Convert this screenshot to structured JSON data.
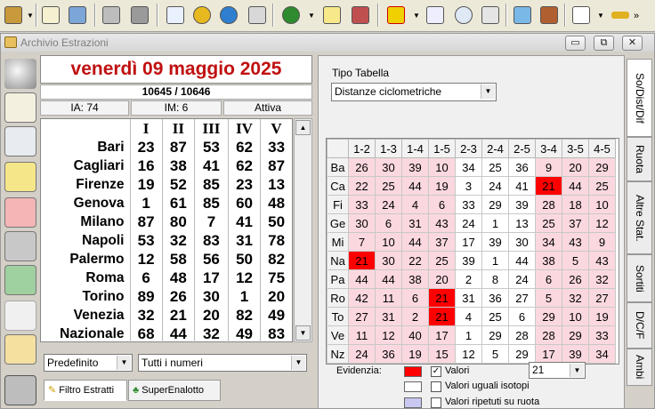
{
  "window": {
    "title": "Archivio Estrazioni",
    "btn_min": "▭",
    "btn_restore": "⧉",
    "btn_close": "✕"
  },
  "toolbar": {
    "icons": [
      "tools-icon",
      "edit-icon",
      "network-icon",
      "copy-icon",
      "clipboard-icon",
      "chart-icon",
      "coins-icon",
      "globe-icon",
      "filter-icon",
      "clover-icon",
      "ticket-icon",
      "package-icon",
      "square-icon",
      "window-icon",
      "magnifier-icon",
      "grid-icon",
      "notebook-icon",
      "wrench-icon",
      "checklist-icon",
      "key-icon"
    ]
  },
  "left": {
    "date": "venerdì 09 maggio 2025",
    "numbers": "10645 / 10646",
    "ia": "IA: 74",
    "im": "IM: 6",
    "status": "Attiva",
    "headers": [
      "I",
      "II",
      "III",
      "IV",
      "V"
    ],
    "rows": [
      {
        "city": "Bari",
        "v": [
          "23",
          "87",
          "53",
          "62",
          "33"
        ]
      },
      {
        "city": "Cagliari",
        "v": [
          "16",
          "38",
          "41",
          "62",
          "87"
        ]
      },
      {
        "city": "Firenze",
        "v": [
          "19",
          "52",
          "85",
          "23",
          "13"
        ]
      },
      {
        "city": "Genova",
        "v": [
          "1",
          "61",
          "85",
          "60",
          "48"
        ]
      },
      {
        "city": "Milano",
        "v": [
          "87",
          "80",
          "7",
          "41",
          "50"
        ]
      },
      {
        "city": "Napoli",
        "v": [
          "53",
          "32",
          "83",
          "31",
          "78"
        ]
      },
      {
        "city": "Palermo",
        "v": [
          "12",
          "58",
          "56",
          "50",
          "82"
        ]
      },
      {
        "city": "Roma",
        "v": [
          "6",
          "48",
          "17",
          "12",
          "75"
        ]
      },
      {
        "city": "Torino",
        "v": [
          "89",
          "26",
          "30",
          "1",
          "20"
        ]
      },
      {
        "city": "Venezia",
        "v": [
          "32",
          "21",
          "20",
          "82",
          "49"
        ]
      },
      {
        "city": "Nazionale",
        "v": [
          "68",
          "44",
          "32",
          "49",
          "83"
        ]
      }
    ],
    "combo1": "Predefinito",
    "combo2": "Tutti i numeri",
    "tab1": "Filtro Estratti",
    "tab2": "SuperEnalotto"
  },
  "right": {
    "tipo_label": "Tipo Tabella",
    "tipo_value": "Distanze ciclometriche",
    "col_headers": [
      "1-2",
      "1-3",
      "1-4",
      "1-5",
      "2-3",
      "2-4",
      "2-5",
      "3-4",
      "3-5",
      "4-5"
    ],
    "rows": [
      {
        "label": "Ba",
        "v": [
          "26",
          "30",
          "39",
          "10",
          "34",
          "25",
          "36",
          "9",
          "20",
          "29"
        ],
        "c": [
          "p",
          "p",
          "p",
          "p",
          "w",
          "w",
          "w",
          "p",
          "p",
          "p"
        ]
      },
      {
        "label": "Ca",
        "v": [
          "22",
          "25",
          "44",
          "19",
          "3",
          "24",
          "41",
          "21",
          "44",
          "25"
        ],
        "c": [
          "p",
          "p",
          "p",
          "p",
          "w",
          "w",
          "w",
          "r",
          "p",
          "p"
        ]
      },
      {
        "label": "Fi",
        "v": [
          "33",
          "24",
          "4",
          "6",
          "33",
          "29",
          "39",
          "28",
          "18",
          "10"
        ],
        "c": [
          "p",
          "p",
          "p",
          "p",
          "w",
          "w",
          "w",
          "p",
          "p",
          "p"
        ]
      },
      {
        "label": "Ge",
        "v": [
          "30",
          "6",
          "31",
          "43",
          "24",
          "1",
          "13",
          "25",
          "37",
          "12"
        ],
        "c": [
          "p",
          "p",
          "p",
          "p",
          "w",
          "w",
          "w",
          "p",
          "p",
          "p"
        ]
      },
      {
        "label": "Mi",
        "v": [
          "7",
          "10",
          "44",
          "37",
          "17",
          "39",
          "30",
          "34",
          "43",
          "9"
        ],
        "c": [
          "p",
          "p",
          "p",
          "p",
          "w",
          "w",
          "w",
          "p",
          "p",
          "p"
        ]
      },
      {
        "label": "Na",
        "v": [
          "21",
          "30",
          "22",
          "25",
          "39",
          "1",
          "44",
          "38",
          "5",
          "43"
        ],
        "c": [
          "r",
          "p",
          "p",
          "p",
          "w",
          "w",
          "w",
          "p",
          "p",
          "p"
        ]
      },
      {
        "label": "Pa",
        "v": [
          "44",
          "44",
          "38",
          "20",
          "2",
          "8",
          "24",
          "6",
          "26",
          "32"
        ],
        "c": [
          "p",
          "p",
          "p",
          "p",
          "w",
          "w",
          "w",
          "p",
          "p",
          "p"
        ]
      },
      {
        "label": "Ro",
        "v": [
          "42",
          "11",
          "6",
          "21",
          "31",
          "36",
          "27",
          "5",
          "32",
          "27"
        ],
        "c": [
          "p",
          "p",
          "p",
          "r",
          "w",
          "w",
          "w",
          "p",
          "p",
          "p"
        ]
      },
      {
        "label": "To",
        "v": [
          "27",
          "31",
          "2",
          "21",
          "4",
          "25",
          "6",
          "29",
          "10",
          "19"
        ],
        "c": [
          "p",
          "p",
          "p",
          "r",
          "w",
          "w",
          "w",
          "p",
          "p",
          "p"
        ]
      },
      {
        "label": "Ve",
        "v": [
          "11",
          "12",
          "40",
          "17",
          "1",
          "29",
          "28",
          "28",
          "29",
          "33"
        ],
        "c": [
          "p",
          "p",
          "p",
          "p",
          "w",
          "w",
          "w",
          "p",
          "p",
          "p"
        ]
      },
      {
        "label": "Nz",
        "v": [
          "24",
          "36",
          "19",
          "15",
          "12",
          "5",
          "29",
          "17",
          "39",
          "34"
        ],
        "c": [
          "p",
          "p",
          "p",
          "p",
          "w",
          "w",
          "w",
          "p",
          "p",
          "p"
        ]
      }
    ],
    "evidenzia_label": "Evidenzia:",
    "valori_label": "Valori",
    "valori_value": "21",
    "uguali_label": "Valori uguali isotopi",
    "ripetuti_label": "Valori ripetuti su ruota",
    "colors": {
      "valori": "#ff0000",
      "uguali": "#ffffff",
      "ripetuti": "#c8c8f0",
      "pink": "#fbd8df"
    }
  },
  "vtabs": [
    "So/Dist/Dif",
    "Ruota",
    "Altre Stat.",
    "Sortiti",
    "D/C/F",
    "Ambi"
  ]
}
